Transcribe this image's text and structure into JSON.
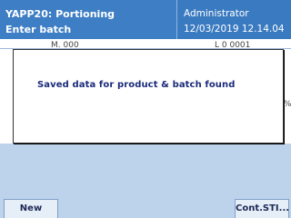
{
  "header": {
    "title": "YAPP20: Portioning",
    "subtitle": "Enter batch",
    "user": "Administrator",
    "datetime": "12/03/2019 12.14.04"
  },
  "background": {
    "frag_left": "M. 000",
    "frag_right": "L 0 0001",
    "frag_pct": "%"
  },
  "dialog": {
    "message": "Saved data for product & batch found"
  },
  "footer": {
    "new_label": "New",
    "cont_label": "Cont.STI..."
  }
}
